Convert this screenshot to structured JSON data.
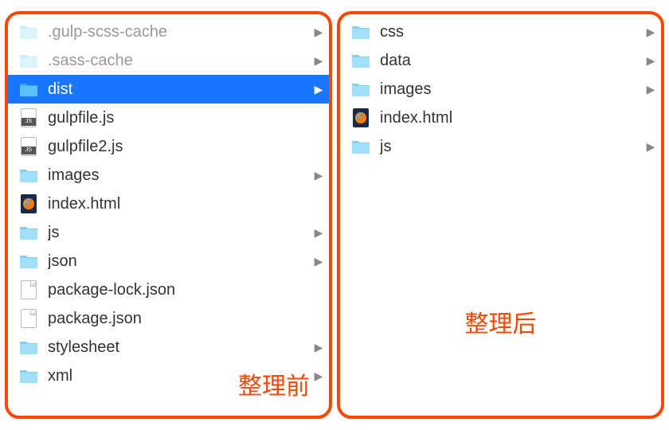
{
  "labels": {
    "before": "整理前",
    "after": "整理后"
  },
  "leftPane": {
    "items": [
      {
        "name": ".gulp-scss-cache",
        "type": "folder",
        "hasChevron": true,
        "faded": true,
        "selected": false
      },
      {
        "name": ".sass-cache",
        "type": "folder",
        "hasChevron": true,
        "faded": true,
        "selected": false
      },
      {
        "name": "dist",
        "type": "folder",
        "hasChevron": true,
        "faded": false,
        "selected": true
      },
      {
        "name": "gulpfile.js",
        "type": "js",
        "hasChevron": false,
        "faded": false,
        "selected": false
      },
      {
        "name": "gulpfile2.js",
        "type": "js",
        "hasChevron": false,
        "faded": false,
        "selected": false
      },
      {
        "name": "images",
        "type": "folder",
        "hasChevron": true,
        "faded": false,
        "selected": false
      },
      {
        "name": "index.html",
        "type": "html",
        "hasChevron": false,
        "faded": false,
        "selected": false
      },
      {
        "name": "js",
        "type": "folder",
        "hasChevron": true,
        "faded": false,
        "selected": false
      },
      {
        "name": "json",
        "type": "folder",
        "hasChevron": true,
        "faded": false,
        "selected": false
      },
      {
        "name": "package-lock.json",
        "type": "file",
        "hasChevron": false,
        "faded": false,
        "selected": false
      },
      {
        "name": "package.json",
        "type": "file",
        "hasChevron": false,
        "faded": false,
        "selected": false
      },
      {
        "name": "stylesheet",
        "type": "folder",
        "hasChevron": true,
        "faded": false,
        "selected": false
      },
      {
        "name": "xml",
        "type": "folder",
        "hasChevron": true,
        "faded": false,
        "selected": false
      }
    ]
  },
  "rightPane": {
    "items": [
      {
        "name": "css",
        "type": "folder",
        "hasChevron": true,
        "faded": false,
        "selected": false
      },
      {
        "name": "data",
        "type": "folder",
        "hasChevron": true,
        "faded": false,
        "selected": false
      },
      {
        "name": "images",
        "type": "folder",
        "hasChevron": true,
        "faded": false,
        "selected": false
      },
      {
        "name": "index.html",
        "type": "html",
        "hasChevron": false,
        "faded": false,
        "selected": false
      },
      {
        "name": "js",
        "type": "folder",
        "hasChevron": true,
        "faded": false,
        "selected": false
      }
    ]
  }
}
